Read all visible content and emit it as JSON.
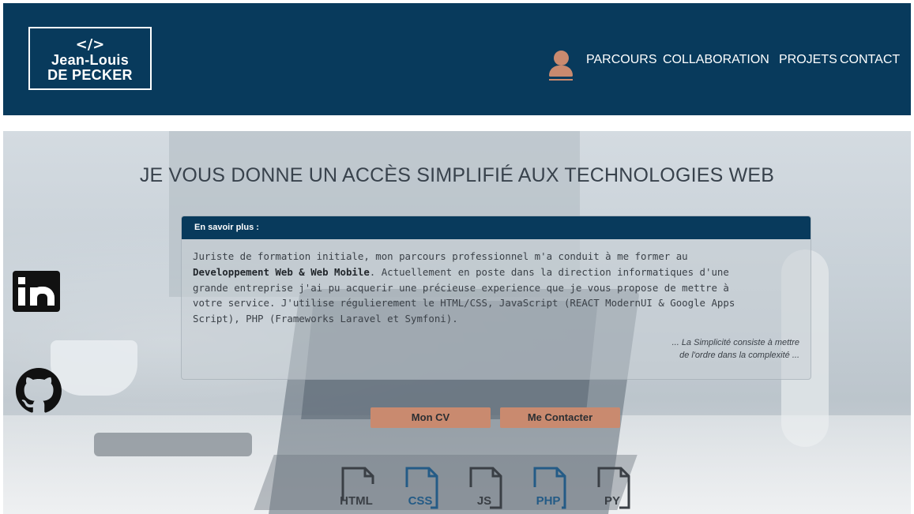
{
  "header": {
    "logo": {
      "code": "</>",
      "line1": "Jean-Louis",
      "line2": "DE PECKER"
    },
    "nav": [
      "PARCOURS",
      "COLLABORATION",
      "PROJETS",
      "CONTACT"
    ]
  },
  "hero": {
    "title": "JE VOUS DONNE UN ACCÈS SIMPLIFIÉ AUX TECHNOLOGIES WEB",
    "card": {
      "header": "En savoir plus :",
      "body_line1": "Juriste de formation initiale, mon parcours professionnel m'a conduit à me former au",
      "body_bold": "Developpement Web & Web Mobile",
      "body_line2_rest": ". Actuellement en poste dans la direction informatiques d'une",
      "body_line3": "grande entreprise j'ai pu acquerir une précieuse experience que je vous propose de mettre à",
      "body_line4": "votre service. J'utilise régulierement le HTML/CSS, JavaScript (REACT ModernUI & Google Apps",
      "body_line5": "Script), PHP (Frameworks Laravel et Symfoni).",
      "quote_line1": "... La Simplicité consiste à mettre",
      "quote_line2": "de l'ordre dans la complexité ..."
    },
    "buttons": {
      "cv": "Mon CV",
      "contact": "Me Contacter"
    },
    "technologies": [
      {
        "label": "HTML",
        "color": "#3a3f45"
      },
      {
        "label": "CSS",
        "color": "#245b86"
      },
      {
        "label": "JS",
        "color": "#3a3f45"
      },
      {
        "label": "PHP",
        "color": "#245b86"
      },
      {
        "label": "PY",
        "color": "#3a3f45"
      }
    ]
  },
  "colors": {
    "primary": "#083a5c",
    "accent": "#c98a6f"
  },
  "icons": [
    "user-icon",
    "linkedin-icon",
    "github-icon",
    "file-icon"
  ]
}
